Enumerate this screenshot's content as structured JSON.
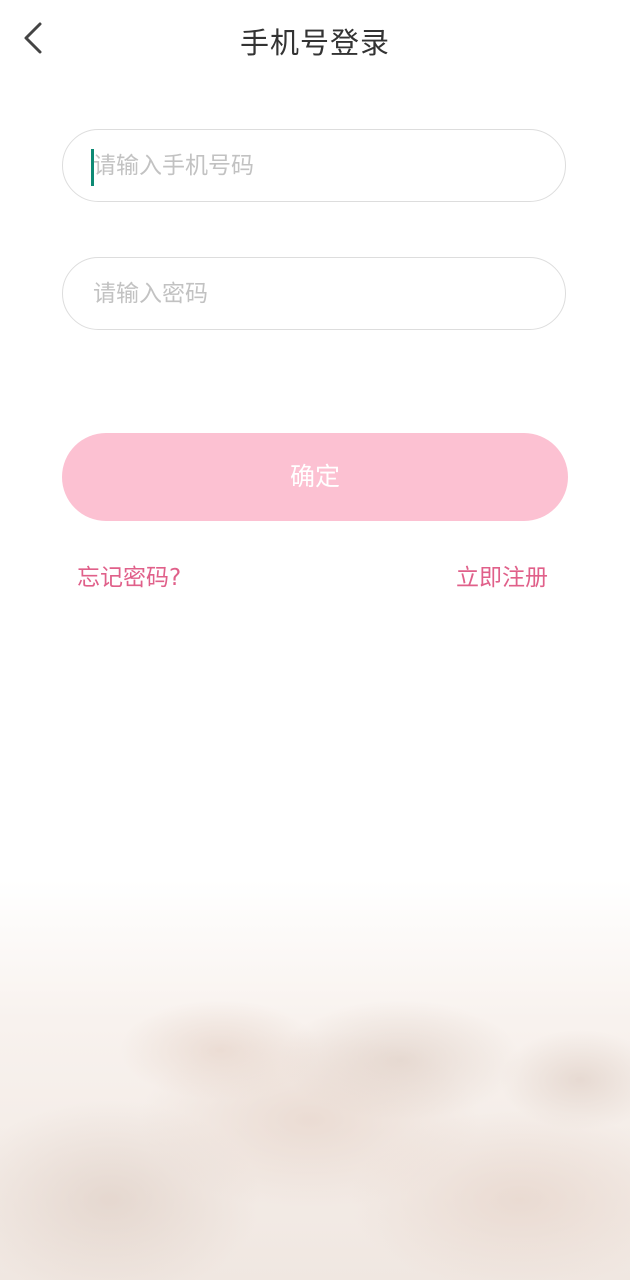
{
  "header": {
    "title": "手机号登录",
    "back_icon": "chevron-left-icon"
  },
  "form": {
    "phone_placeholder": "请输入手机号码",
    "phone_value": "",
    "password_placeholder": "请输入密码",
    "password_value": ""
  },
  "actions": {
    "confirm_label": "确定",
    "forgot_password_label": "忘记密码?",
    "register_label": "立即注册"
  },
  "colors": {
    "accent_pink": "#e0608a",
    "button_pink": "#fcc1d2",
    "caret_green": "#0d8a74"
  }
}
